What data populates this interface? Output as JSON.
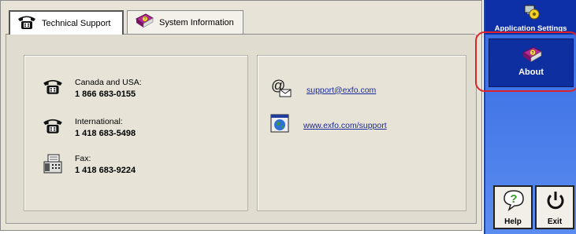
{
  "tabs": [
    {
      "label": "Technical Support",
      "icon": "phone-icon",
      "active": true
    },
    {
      "label": "System Information",
      "icon": "book-icon",
      "active": false
    }
  ],
  "contacts": [
    {
      "label": "Canada and USA:",
      "number": "1 866 683-0155",
      "icon": "phone-icon"
    },
    {
      "label": "International:",
      "number": "1 418 683-5498",
      "icon": "phone-icon"
    },
    {
      "label": "Fax:",
      "number": "1 418 683-9224",
      "icon": "fax-icon"
    }
  ],
  "links": [
    {
      "text": "support@exfo.com",
      "icon": "email-icon"
    },
    {
      "text": "www.exfo.com/support",
      "icon": "web-icon"
    }
  ],
  "sidebar": {
    "app_settings_label": "Application Settings",
    "about_label": "About",
    "help_label": "Help",
    "exit_label": "Exit"
  },
  "colors": {
    "sidebar_blue": "#3367e0",
    "sidebar_dark": "#0d2fa8",
    "highlight_red": "#e0222b",
    "link_blue": "#1a2a9a"
  }
}
